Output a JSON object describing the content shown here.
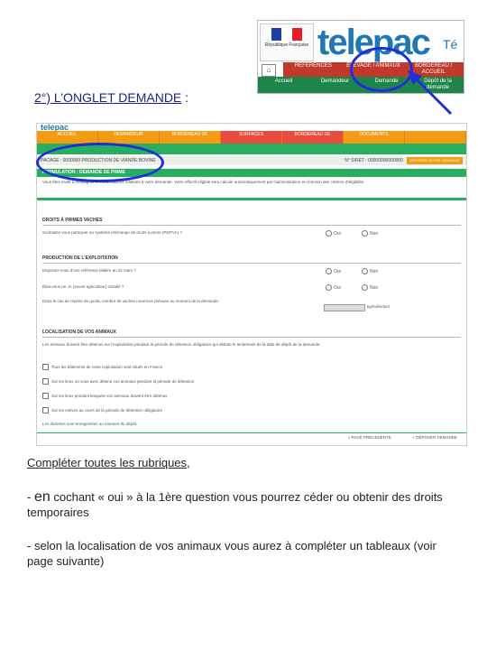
{
  "header": {
    "republique": "République Française",
    "brand": "telepac",
    "brand_tail": "Té",
    "nav_top": [
      "RÉFÉRENCES",
      "ÉLEVAGE / ANIMAUX",
      "BORDEREAU / ACCUEIL"
    ],
    "nav_bottom": [
      "Accueil",
      "Demandeur",
      "Demande",
      "Dépôt de la demande"
    ]
  },
  "section": {
    "title": "2°) L’ONGLET DEMANDE",
    "colon": ":"
  },
  "shot": {
    "top_text": "telepac",
    "orange_nav": [
      "ACCUEIL",
      "DEMANDEUR",
      "BORDEREAU DE",
      "SURFACES",
      "BORDEREAU DE",
      "DOCUMENTS",
      ""
    ],
    "sub_bar_left": "PACAGE : 0000000     PRODUCTION DE VIANDE BOVINE",
    "sub_bar_right": "N° SIRET : 00000000000000",
    "sub_bar_button": "DÉPOSER VOTRE DEMANDE",
    "green_title": "FORMULATION : DEMANDE DE PRIME",
    "para": "Vous êtes invité à renseigner les informations relatives à votre demande. Votre effectif éligible sera calculé automatiquement par l'administration en fonction des critères d'éligibilité.",
    "block1_title": "DROITS À PRIMES VACHES",
    "block1_q": "Souhaitez-vous participer au système d'échange de droits à prime (PMTVA) ?",
    "radio_yes": "Oui",
    "radio_no": "Non",
    "block2_title": "PRODUCTION DE L'EXPLOITATION",
    "block2_q1": "Disposez-vous d'une référence laitière au 31 mars ?",
    "block2_q2": "Êtes-vous un JA (Jeune agriculteur) installé ?",
    "block2_q3": "Dans le cas de reprise de quota, nombre de vaches nourrices prévues au moment de la demande :",
    "unit_text": "kg/individuel",
    "block3_title": "LOCALISATION DE VOS ANIMAUX",
    "block3_para": "Les animaux doivent être détenus sur l'exploitation pendant la période de détention obligatoire qui débute le lendemain de la date de dépôt de la demande.",
    "checks": [
      "Tous les bâtiments de votre exploitation sont situés en France",
      "Sur les lieux où vous avez détenu vos animaux pendant la période de détention",
      "Sur les lieux pendant lesquels vos animaux doivent être détenus",
      "Sur les estives au cours de la période de détention obligatoire"
    ],
    "footnote": "Les données sont enregistrées au moment du dépôt.",
    "foot_prev": "PAGE PRÉCÉDENTE",
    "foot_next": "DÉPOSER DEMANDE"
  },
  "instructions": {
    "line1": "Compléter toutes les rubriques,",
    "line2_prefix": "- ",
    "line2_en": "en",
    "line2_rest": " cochant « oui » à la 1ère question vous pourrez céder ou obtenir des droits temporaires",
    "line3": "- selon la localisation de vos animaux vous aurez à compléter un tableaux (voir page suivante)"
  }
}
